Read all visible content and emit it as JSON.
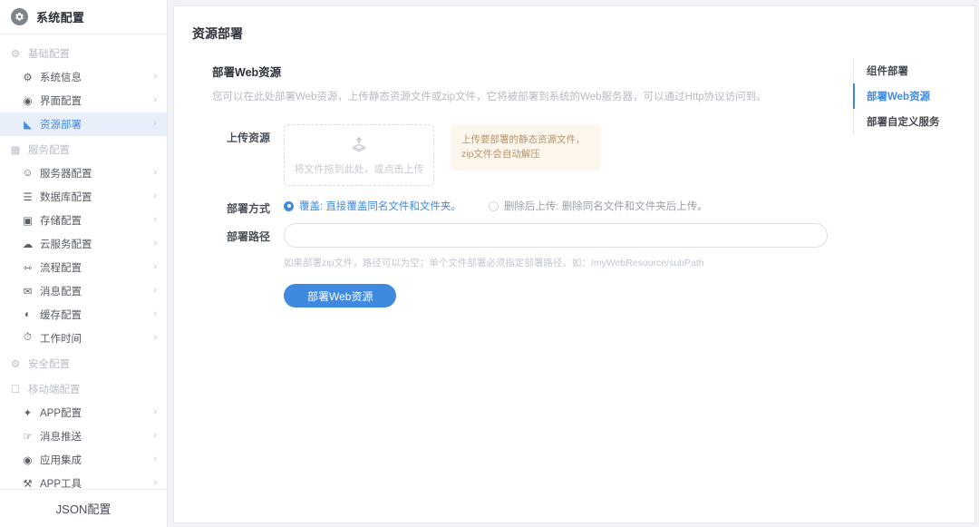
{
  "sidebar": {
    "brand": {
      "title": "系统配置",
      "icon": "gear-icon"
    },
    "groups": [
      {
        "title": "基础配置",
        "icon": "gear-icon",
        "items": [
          {
            "label": "系统信息",
            "icon": "gear-icon",
            "active": false
          },
          {
            "label": "界面配置",
            "icon": "palette-icon",
            "active": false
          },
          {
            "label": "资源部署",
            "icon": "upload-cloud-icon",
            "active": true
          }
        ]
      },
      {
        "title": "服务配置",
        "icon": "server-icon",
        "items": [
          {
            "label": "服务器配置",
            "icon": "server-user-icon",
            "active": false
          },
          {
            "label": "数据库配置",
            "icon": "database-icon",
            "active": false
          },
          {
            "label": "存储配置",
            "icon": "storage-icon",
            "active": false
          },
          {
            "label": "云服务配置",
            "icon": "cloud-icon",
            "active": false
          },
          {
            "label": "流程配置",
            "icon": "flow-icon",
            "active": false
          },
          {
            "label": "消息配置",
            "icon": "message-icon",
            "active": false
          },
          {
            "label": "缓存配置",
            "icon": "cache-icon",
            "active": false
          },
          {
            "label": "工作时间",
            "icon": "clock-icon",
            "active": false
          }
        ]
      },
      {
        "title": "安全配置",
        "icon": "shield-icon",
        "items": []
      },
      {
        "title": "移动端配置",
        "icon": "mobile-icon",
        "items": [
          {
            "label": "APP配置",
            "icon": "rocket-icon",
            "active": false
          },
          {
            "label": "消息推送",
            "icon": "push-icon",
            "active": false
          },
          {
            "label": "应用集成",
            "icon": "integration-icon",
            "active": false
          },
          {
            "label": "APP工具",
            "icon": "tools-icon",
            "active": false
          }
        ]
      }
    ],
    "footer_label": "JSON配置",
    "chevron": "›"
  },
  "page": {
    "title": "资源部署"
  },
  "section": {
    "title": "部署Web资源",
    "description": "您可以在此处部署Web资源，上传静态资源文件或zip文件，它将被部署到系统的Web服务器，可以通过Http协议访问到。"
  },
  "form": {
    "upload": {
      "label": "上传资源",
      "dropzone_text": "将文件拖到此处，或点击上传",
      "dropzone_icon": "upload-icon",
      "tip": "上传要部署的静态资源文件，zip文件会自动解压"
    },
    "deploy_method": {
      "label": "部署方式",
      "options": [
        {
          "label": "覆盖: 直接覆盖同名文件和文件夹。",
          "selected": true
        },
        {
          "label": "删除后上传: 删除同名文件和文件夹后上传。",
          "selected": false
        }
      ]
    },
    "deploy_path": {
      "label": "部署路径",
      "value": "",
      "placeholder": "",
      "hint": "如果部署zip文件，路径可以为空；单个文件部署必须指定部署路径。如：/myWebResource/subPath"
    },
    "submit_label": "部署Web资源"
  },
  "rightnav": {
    "items": [
      {
        "label": "组件部署",
        "active": false
      },
      {
        "label": "部署Web资源",
        "active": true
      },
      {
        "label": "部署自定义服务",
        "active": false
      }
    ]
  },
  "colors": {
    "accent": "#3f8ae0",
    "active_bg": "#e8effb",
    "tip_bg": "#fdf6ec",
    "tip_text": "#b79468",
    "page_bg": "#f0f2f5"
  }
}
